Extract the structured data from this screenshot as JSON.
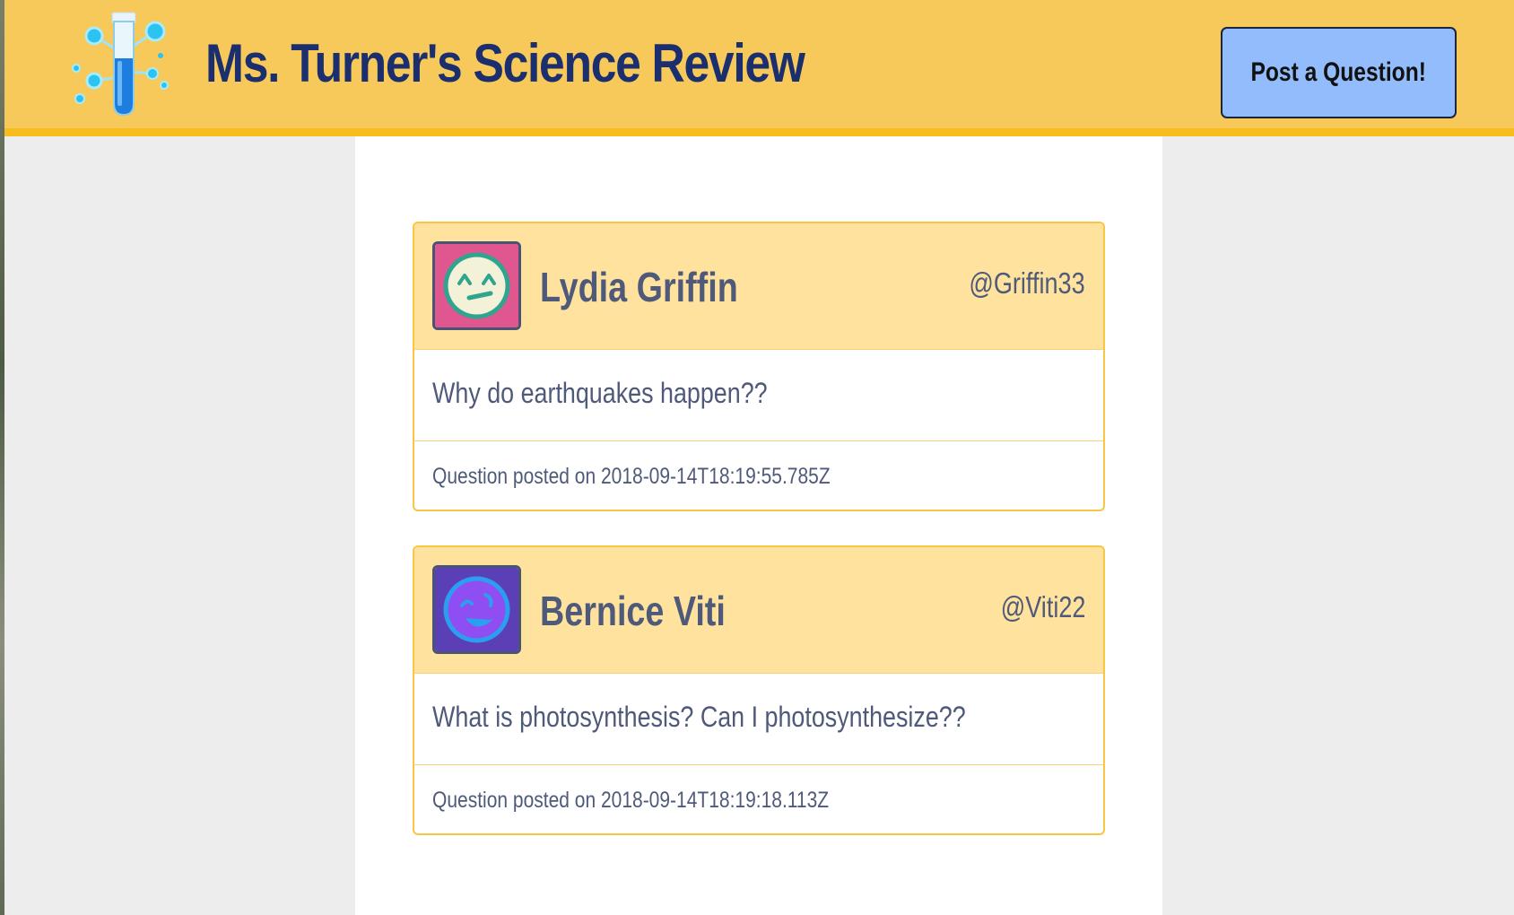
{
  "header": {
    "title": "Ms. Turner's Science Review",
    "post_button_label": "Post a Question!",
    "logo_icon": "test-tube-molecule-icon",
    "background_color": "#f6c95a",
    "accent_color": "#f7bd1c",
    "title_color": "#1b2f6e"
  },
  "questions": [
    {
      "name": "Lydia Griffin",
      "handle": "@Griffin33",
      "avatar_icon": "grimacing-face-icon",
      "avatar_bg": "#e0568e",
      "question": "Why do earthquakes happen??",
      "posted_label": "Question posted on",
      "timestamp": "2018-09-14T18:19:55.785Z"
    },
    {
      "name": "Bernice Viti",
      "handle": "@Viti22",
      "avatar_icon": "laughing-face-icon",
      "avatar_bg": "#5a3fb6",
      "question": "What is photosynthesis? Can I photosynthesize??",
      "posted_label": "Question posted on",
      "timestamp": "2018-09-14T18:19:18.113Z"
    }
  ]
}
